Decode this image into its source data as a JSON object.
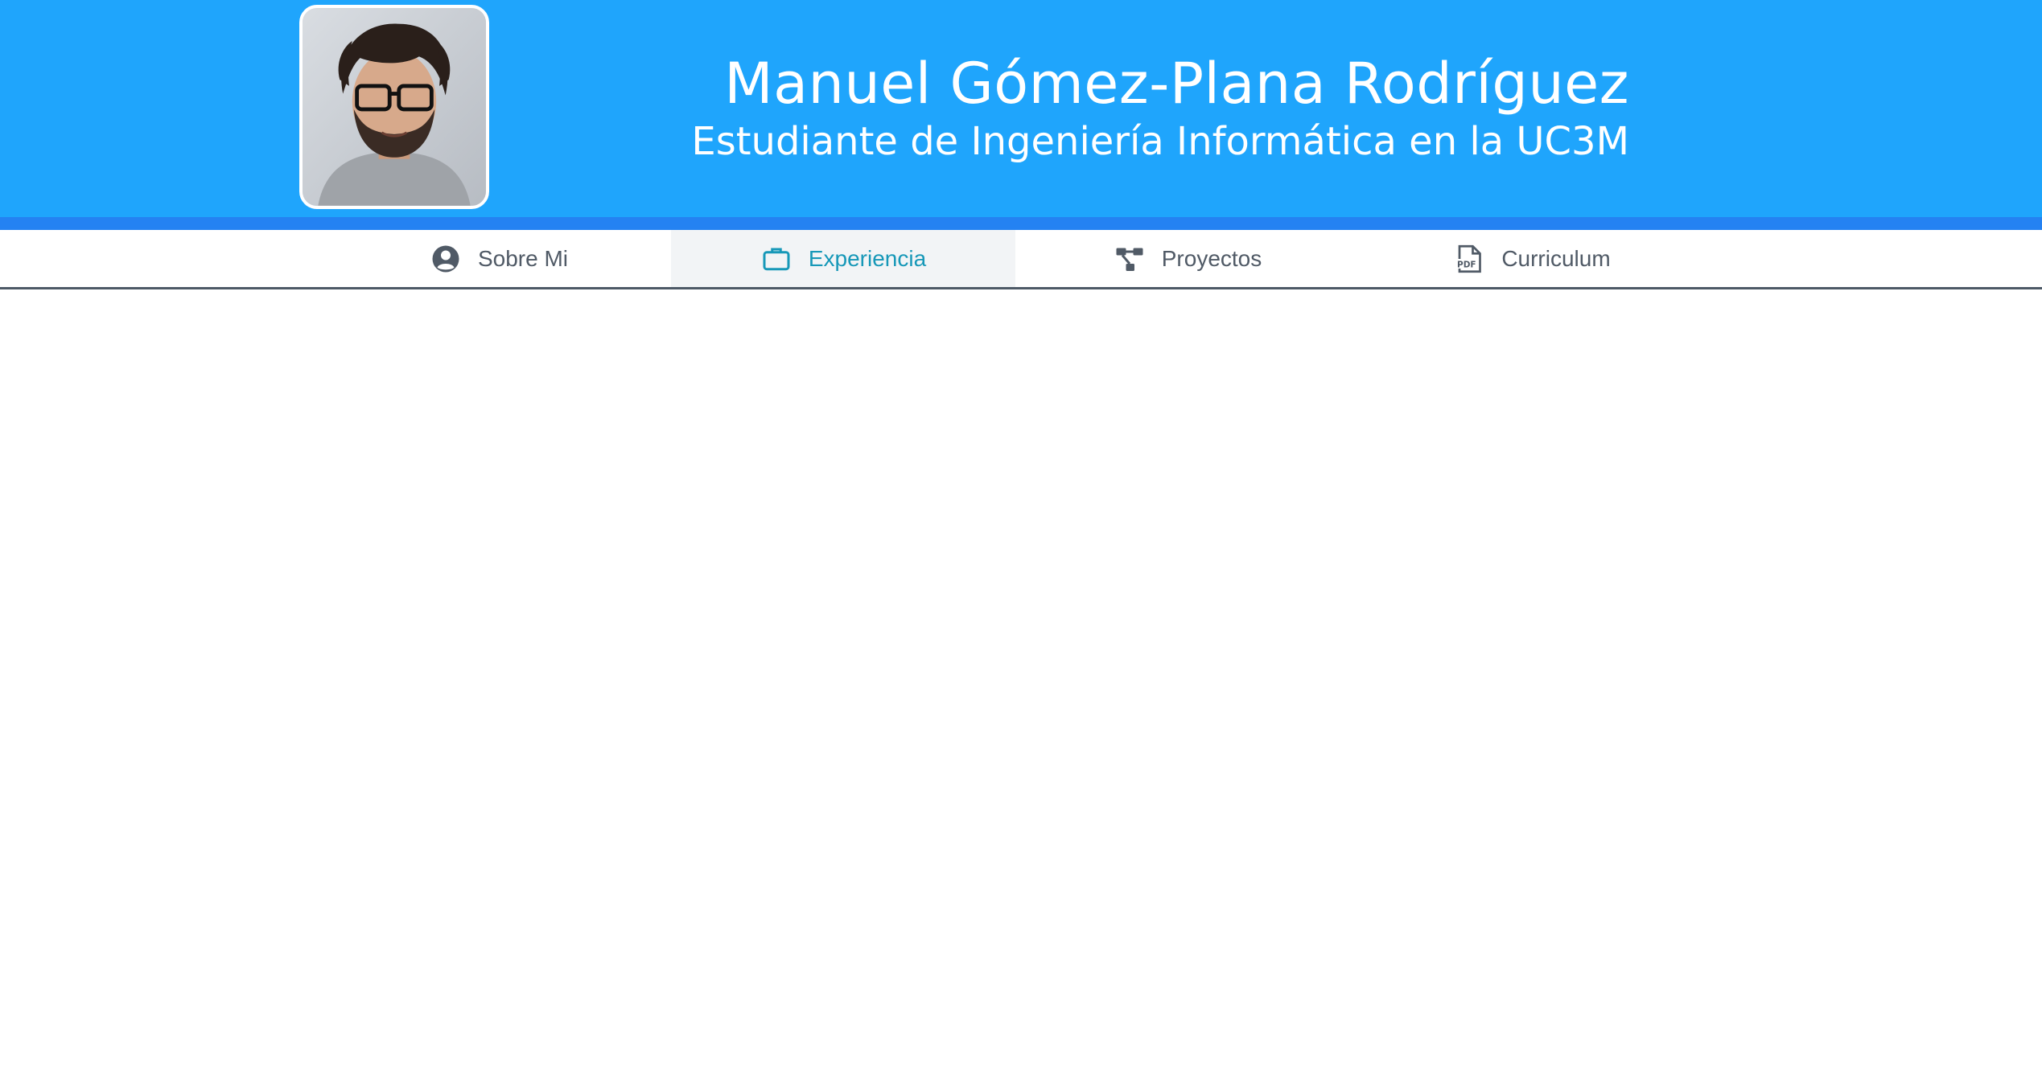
{
  "header": {
    "name": "Manuel Gómez-Plana Rodríguez",
    "subtitle": "Estudiante de Ingeniería Informática en la UC3M",
    "avatar_alt": "Manuel Gómez-Plana Rodríguez",
    "background_color": "#1fa5fc",
    "stripe_color": "#2482f2"
  },
  "nav": {
    "items": [
      {
        "label": "Sobre Mi",
        "icon": "user-circle-icon",
        "active": false
      },
      {
        "label": "Experiencia",
        "icon": "briefcase-icon",
        "active": true
      },
      {
        "label": "Proyectos",
        "icon": "diagram-icon",
        "active": false
      },
      {
        "label": "Curriculum",
        "icon": "pdf-file-icon",
        "active": false
      }
    ],
    "active_color": "#1798b8",
    "text_color": "#505a66"
  }
}
